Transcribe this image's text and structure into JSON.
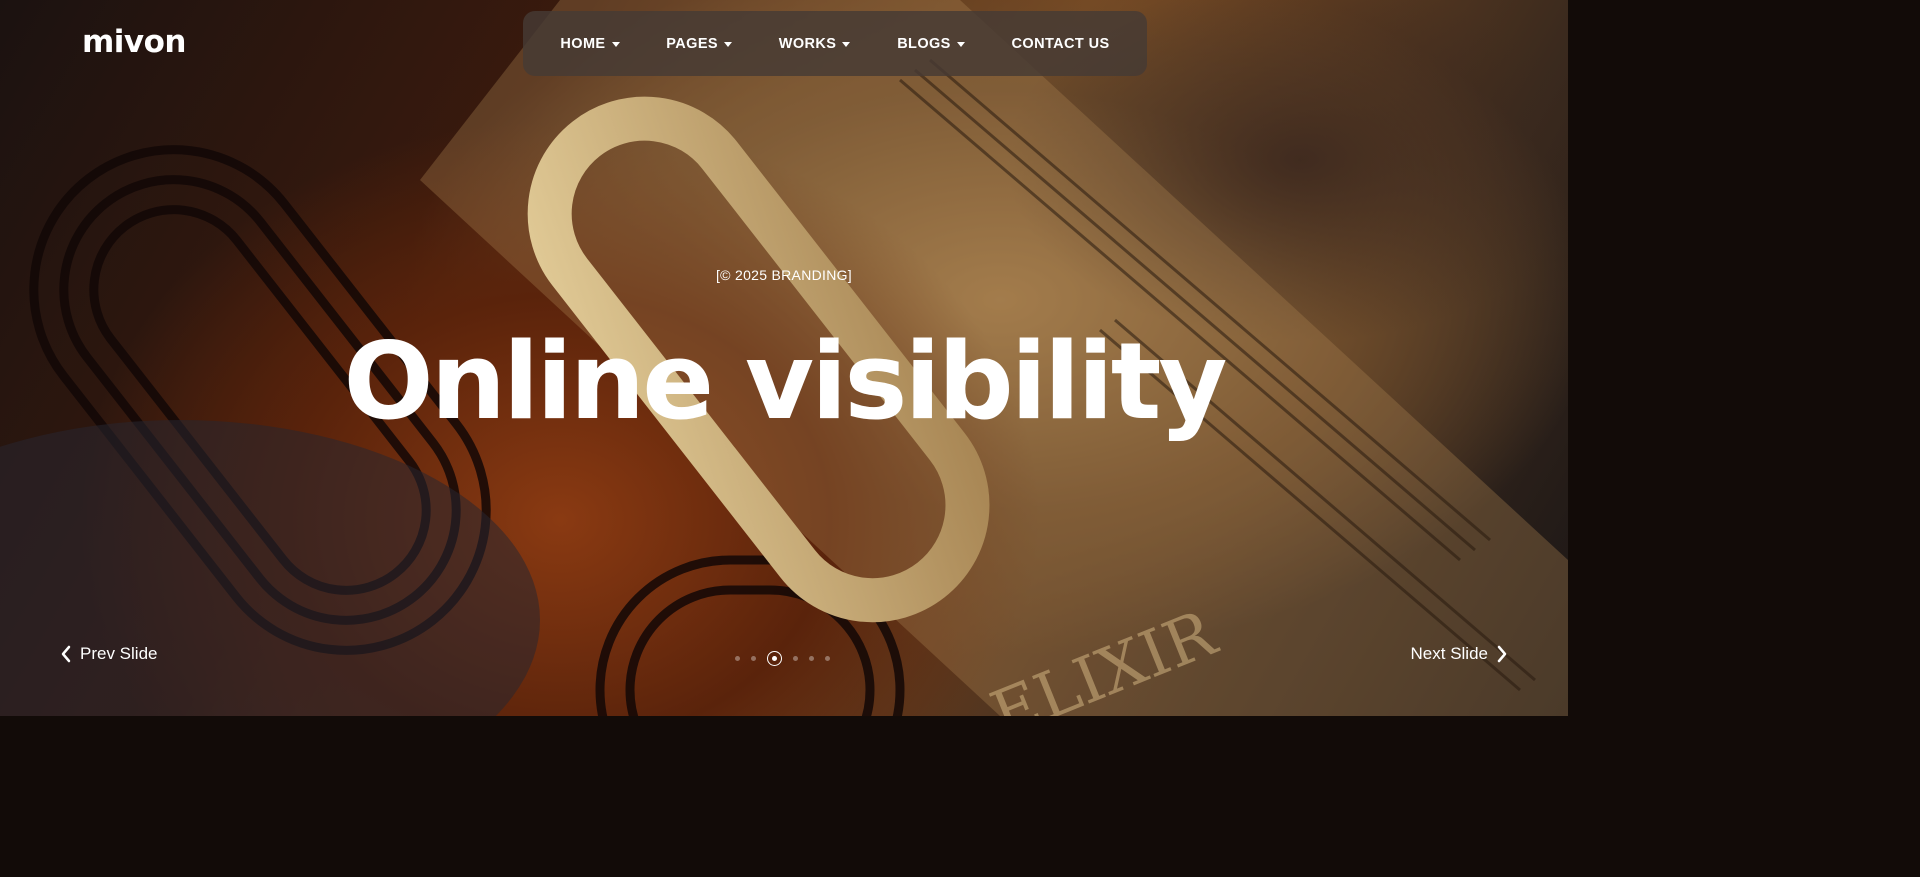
{
  "brand": {
    "logo": "mivon"
  },
  "nav": {
    "items": [
      {
        "label": "HOME",
        "dropdown": true
      },
      {
        "label": "PAGES",
        "dropdown": true
      },
      {
        "label": "WORKS",
        "dropdown": true
      },
      {
        "label": "BLOGS",
        "dropdown": true
      },
      {
        "label": "CONTACT US",
        "dropdown": false
      }
    ]
  },
  "hero": {
    "eyebrow": "[© 2025 BRANDING]",
    "headline": "Online visibility",
    "background_text": "ELIXIR"
  },
  "slider": {
    "prev_label": "Prev Slide",
    "next_label": "Next Slide",
    "total_slides": 6,
    "active_slide": 3
  },
  "colors": {
    "accent_copper": "#8a3a12",
    "gold": "#c8a66a",
    "nav_bg": "#463a34"
  }
}
